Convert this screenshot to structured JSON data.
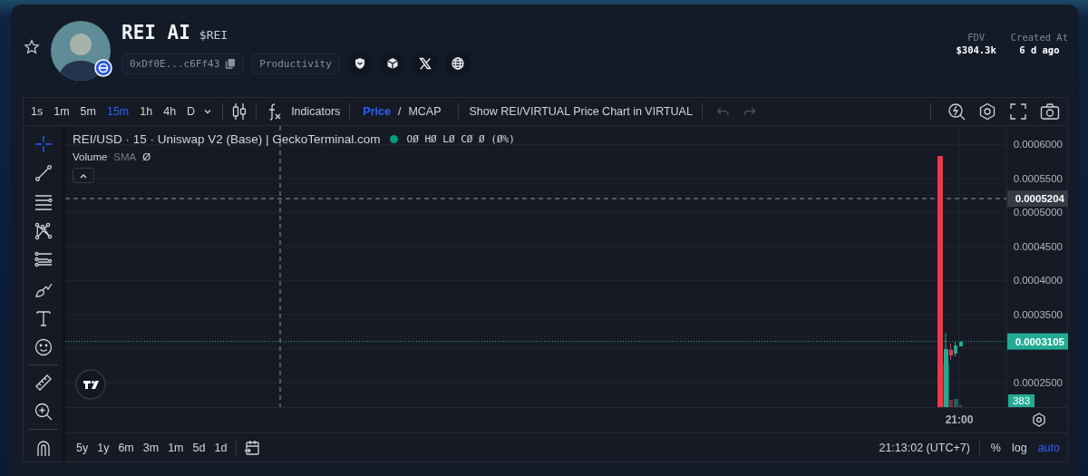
{
  "token": {
    "name": "REI AI",
    "ticker": "$REI",
    "address": "0xDf0E...c6Ff43",
    "category": "Productivity",
    "favorited": false
  },
  "stats": [
    {
      "label": "FDV",
      "value": "$304.3k"
    },
    {
      "label": "Created At",
      "value": "6 d ago"
    }
  ],
  "toolbar": {
    "intervals": [
      {
        "label": "1s",
        "selected": false
      },
      {
        "label": "1m",
        "selected": false
      },
      {
        "label": "5m",
        "selected": false
      },
      {
        "label": "15m",
        "selected": true
      },
      {
        "label": "1h",
        "selected": false
      },
      {
        "label": "4h",
        "selected": false
      },
      {
        "label": "D",
        "selected": false
      }
    ],
    "indicators_label": "Indicators",
    "price_modes": [
      {
        "label": "Price",
        "selected": true
      },
      {
        "label": "MCAP",
        "selected": false
      }
    ],
    "mode_separator": "/",
    "pair_toggle": "Show REI/VIRTUAL Price Chart in VIRTUAL",
    "undo": {
      "disabled": true
    },
    "redo": {
      "disabled": true
    }
  },
  "drawing_tools": [
    {
      "selected": true
    },
    {
      "selected": false
    },
    {
      "selected": false
    },
    {
      "selected": false
    },
    {
      "selected": false
    },
    {
      "selected": false
    },
    {
      "selected": false
    },
    {
      "selected": false
    },
    {
      "selected": false
    },
    {
      "selected": false
    },
    {
      "selected": false
    }
  ],
  "chart": {
    "legend": "REI/USD · 15 · Uniswap V2 (Base) | GeckoTerminal.com",
    "ohlc": "OØ HØ LØ CØ Ø (Ø%)",
    "volume": {
      "label": "Volume",
      "param": "SMA",
      "value": "Ø"
    },
    "price_ticks": [
      "0.0006000",
      "0.0005500",
      "0.0005000",
      "0.0004500",
      "0.0004000",
      "0.0003500",
      "0.0002500"
    ],
    "crosshair_price": "0.0005204",
    "last_price": "0.0003105",
    "last_volume": "383",
    "time_ticks": [
      "21:00"
    ]
  },
  "footer": {
    "ranges": [
      "5y",
      "1y",
      "6m",
      "3m",
      "1m",
      "5d",
      "1d"
    ],
    "clock": "21:13:02 (UTC+7)",
    "scale_options": [
      {
        "label": "%",
        "selected": false
      },
      {
        "label": "log",
        "selected": false
      },
      {
        "label": "auto",
        "selected": true
      }
    ]
  }
}
